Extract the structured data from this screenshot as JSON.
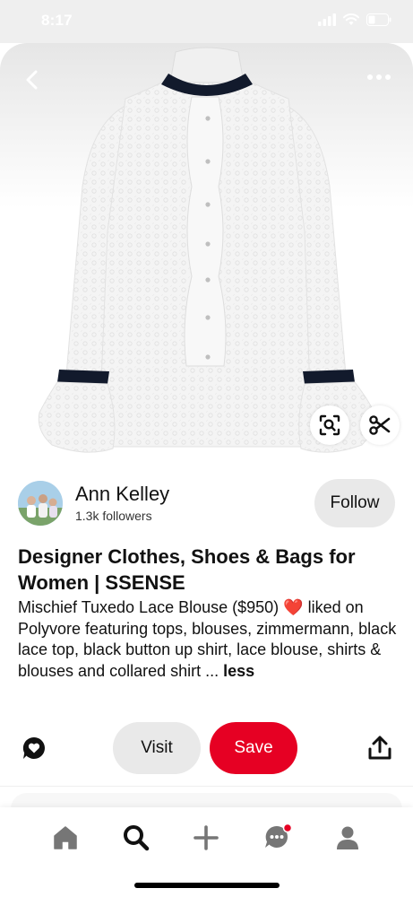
{
  "status_bar": {
    "time": "8:17"
  },
  "pin": {
    "image_subject": "white lace ruffled blouse with black collar and cuffs",
    "icons": {
      "back": "chevron-left-icon",
      "more": "more-horizontal-icon",
      "visual_search": "lens-search-icon",
      "crop": "scissors-icon"
    }
  },
  "creator": {
    "name": "Ann Kelley",
    "followers": "1.3k followers",
    "follow_label": "Follow"
  },
  "content": {
    "title": "Designer Clothes, Shoes & Bags for Women | SSENSE",
    "desc_part1": "Mischief Tuxedo Lace Blouse ($950)",
    "heart_glyph": "❤️",
    "desc_part2": "liked on Polyvore featuring tops, blouses, zimmermann, black lace top, black button up shirt, lace blouse, shirts & blouses and collared shirt ...",
    "less_label": "less"
  },
  "actions": {
    "visit_label": "Visit",
    "save_label": "Save",
    "icons": {
      "comment": "chat-bubble-heart-icon",
      "share": "share-upload-icon"
    }
  },
  "bottom_nav": {
    "items": [
      {
        "name": "home",
        "icon": "home-icon",
        "active": false
      },
      {
        "name": "search",
        "icon": "search-icon",
        "active": true
      },
      {
        "name": "create",
        "icon": "plus-icon",
        "active": false
      },
      {
        "name": "messages",
        "icon": "chat-icon",
        "active": false,
        "badge": true
      },
      {
        "name": "profile",
        "icon": "person-icon",
        "active": false
      }
    ]
  },
  "colors": {
    "brand_red": "#e60023",
    "button_gray": "#e9e9e9",
    "icon_gray": "#767676",
    "text": "#111111"
  }
}
